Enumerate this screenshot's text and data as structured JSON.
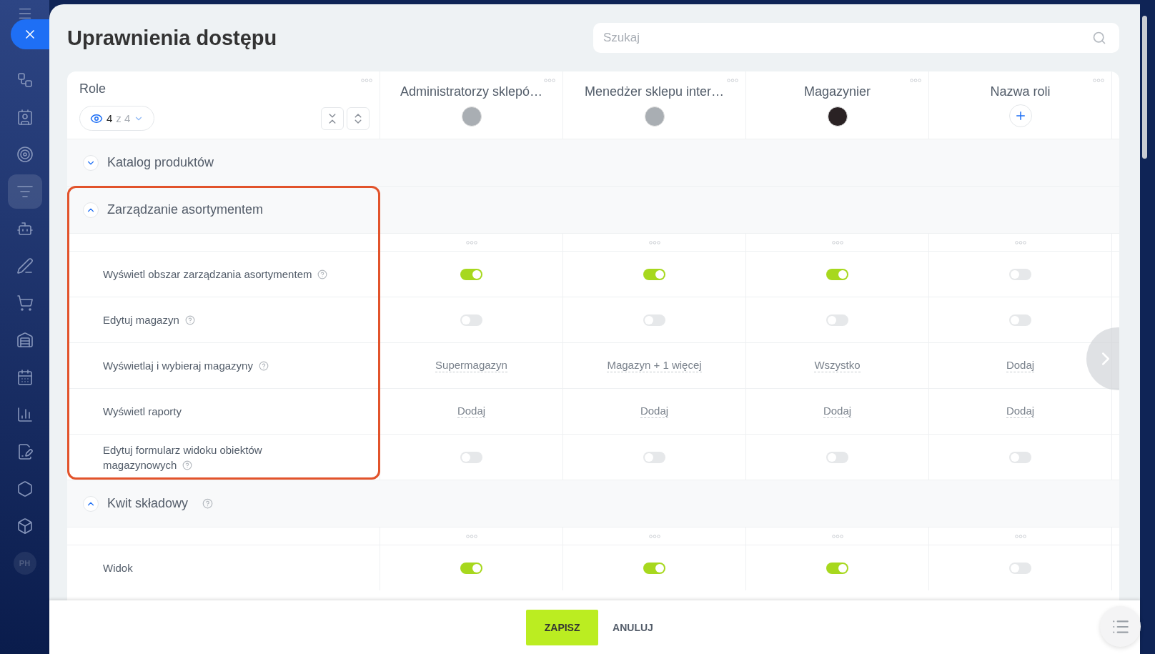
{
  "sidebar": {
    "items": [
      {
        "kind": "icon",
        "selected": false
      },
      {
        "kind": "icon",
        "selected": false
      },
      {
        "kind": "icon",
        "selected": false
      },
      {
        "kind": "icon",
        "selected": true
      },
      {
        "kind": "icon",
        "selected": false
      },
      {
        "kind": "icon",
        "selected": false
      },
      {
        "kind": "icon",
        "selected": false
      },
      {
        "kind": "icon",
        "selected": false
      },
      {
        "kind": "icon",
        "selected": false
      },
      {
        "kind": "icon",
        "selected": false
      },
      {
        "kind": "icon",
        "selected": false
      },
      {
        "kind": "icon",
        "selected": false
      },
      {
        "kind": "icon",
        "selected": false
      },
      {
        "kind": "avatar",
        "initials": "PH",
        "selected": false
      }
    ]
  },
  "title": "Uprawnienia dostępu",
  "search": {
    "placeholder": "Szukaj"
  },
  "roles_header": {
    "label": "Role",
    "visible_count": "4",
    "total_label": "z 4"
  },
  "roles": [
    {
      "name": "Administratorzy sklepó…",
      "kind": "avatar"
    },
    {
      "name": "Menedżer sklepu inter…",
      "kind": "avatar"
    },
    {
      "name": "Magazynier",
      "kind": "avatar"
    },
    {
      "name": "Nazwa roli",
      "kind": "add"
    }
  ],
  "sections": [
    {
      "title": "Katalog produktów",
      "expanded": false,
      "help": false,
      "highlighted": false
    },
    {
      "title": "Zarządzanie asortymentem",
      "expanded": true,
      "help": false,
      "highlighted": true,
      "rows": [
        {
          "label": "Wyświetl obszar zarządzania asortymentem",
          "help": true,
          "cells": [
            {
              "kind": "toggle",
              "on": true
            },
            {
              "kind": "toggle",
              "on": true
            },
            {
              "kind": "toggle",
              "on": true
            },
            {
              "kind": "toggle",
              "on": false
            }
          ]
        },
        {
          "label": "Edytuj magazyn",
          "help": true,
          "cells": [
            {
              "kind": "toggle",
              "on": false
            },
            {
              "kind": "toggle",
              "on": false
            },
            {
              "kind": "toggle",
              "on": false
            },
            {
              "kind": "toggle",
              "on": false
            }
          ]
        },
        {
          "label": "Wyświetlaj i wybieraj magazyny",
          "help": true,
          "cells": [
            {
              "kind": "link",
              "text": "Supermagazyn"
            },
            {
              "kind": "link",
              "text": "Magazyn + 1 więcej"
            },
            {
              "kind": "link",
              "text": "Wszystko"
            },
            {
              "kind": "link",
              "text": "Dodaj"
            }
          ]
        },
        {
          "label": "Wyświetl raporty",
          "help": false,
          "cells": [
            {
              "kind": "link",
              "text": "Dodaj"
            },
            {
              "kind": "link",
              "text": "Dodaj"
            },
            {
              "kind": "link",
              "text": "Dodaj"
            },
            {
              "kind": "link",
              "text": "Dodaj"
            }
          ]
        },
        {
          "label": "Edytuj formularz widoku obiektów magazynowych",
          "help": true,
          "cells": [
            {
              "kind": "toggle",
              "on": false
            },
            {
              "kind": "toggle",
              "on": false
            },
            {
              "kind": "toggle",
              "on": false
            },
            {
              "kind": "toggle",
              "on": false
            }
          ]
        }
      ]
    },
    {
      "title": "Kwit składowy",
      "expanded": true,
      "help": true,
      "highlighted": false,
      "rows": [
        {
          "label": "Widok",
          "help": false,
          "cells": [
            {
              "kind": "toggle",
              "on": true
            },
            {
              "kind": "toggle",
              "on": true
            },
            {
              "kind": "toggle",
              "on": true
            },
            {
              "kind": "toggle",
              "on": false
            }
          ]
        }
      ]
    }
  ],
  "footer": {
    "save": "ZAPISZ",
    "cancel": "ANULUJ"
  }
}
